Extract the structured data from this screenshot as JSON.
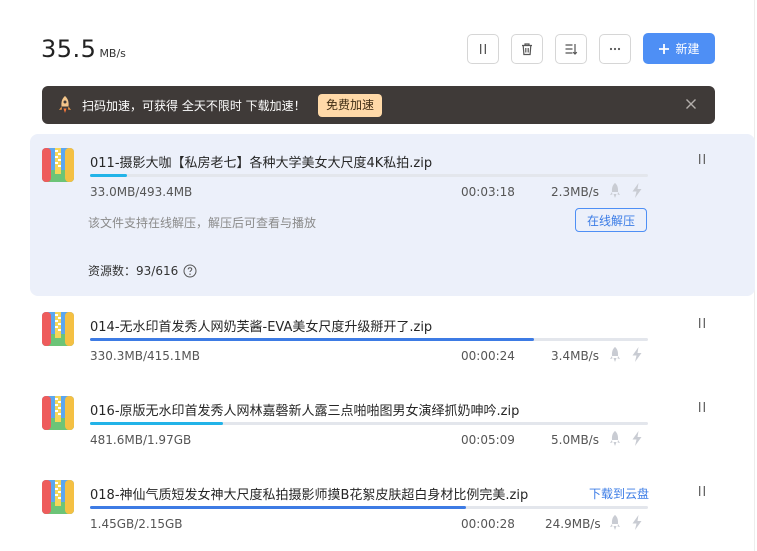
{
  "header": {
    "speed_value": "35.5",
    "speed_unit": "MB/s",
    "new_button_label": "新建"
  },
  "banner": {
    "text": "扫码加速，可获得 全天不限时 下载加速！",
    "cta_label": "免费加速"
  },
  "downloads": [
    {
      "name": "011-摄影大咖【私房老七】各种大学美女大尺度4K私拍.zip",
      "size": "33.0MB/493.4MB",
      "time": "00:03:18",
      "speed": "2.3MB/s",
      "progress": 0.067,
      "hint": "该文件支持在线解压，解压后可查看与播放",
      "unzip_label": "在线解压",
      "sources": "资源数：93/616"
    },
    {
      "name": "014-无水印首发秀人网奶芙酱-EVA美女尺度升级掰开了.zip",
      "size": "330.3MB/415.1MB",
      "time": "00:00:24",
      "speed": "3.4MB/s",
      "progress": 0.796
    },
    {
      "name": "016-原版无水印首发秀人网林嘉磬新人露三点啪啪图男女演绎抓奶呻吟.zip",
      "size": "481.6MB/1.97GB",
      "time": "00:05:09",
      "speed": "5.0MB/s",
      "progress": 0.239
    },
    {
      "name": "018-神仙气质短发女神大尺度私拍摄影师摸B花絮皮肤超白身材比例完美.zip",
      "size": "1.45GB/2.15GB",
      "time": "00:00:28",
      "speed": "24.9MB/s",
      "progress": 0.674,
      "cloud_label": "下载到云盘"
    }
  ],
  "colors": {
    "accent": "#4e8ff5",
    "progress_cyan": "#22b3e8",
    "progress_blue": "#3d7be4",
    "banner_bg": "#3f3a38",
    "banner_cta_bg": "#ffd9a8",
    "selected_bg": "#ecf0fa"
  }
}
